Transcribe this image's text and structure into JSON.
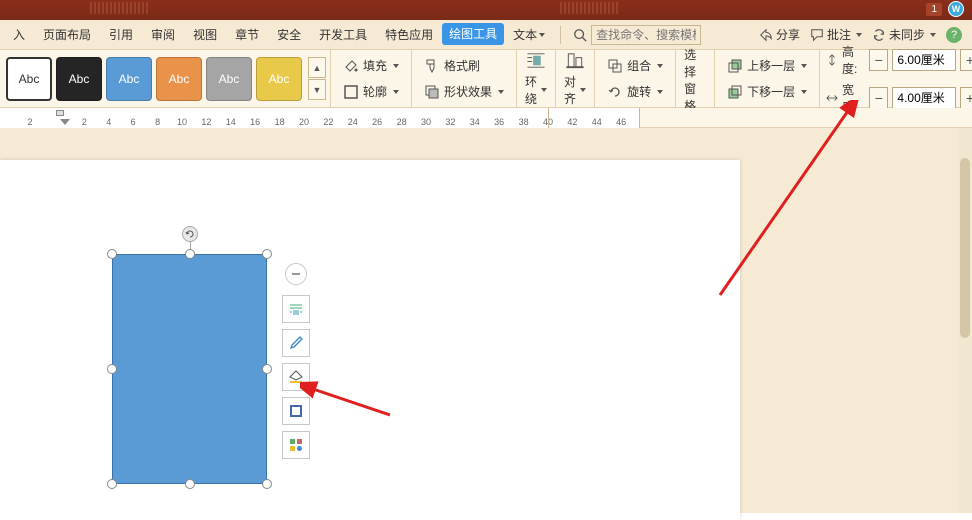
{
  "title_bar": {
    "notif_count": "1"
  },
  "menu": {
    "items": [
      "入",
      "页面布局",
      "引用",
      "审阅",
      "视图",
      "章节",
      "安全",
      "开发工具",
      "特色应用"
    ],
    "active": "绘图工具",
    "text_menu": "文本",
    "search_placeholder": "查找命令、搜索模板"
  },
  "right_menu": {
    "share": "分享",
    "comment": "批注",
    "sync": "未同步"
  },
  "styles": {
    "label": "Abc",
    "colors": [
      "#ffffff",
      "#252525",
      "#5a9bd5",
      "#e8924a",
      "#a5a5a5",
      "#e8c94a"
    ]
  },
  "toolbar": {
    "fill": "填充",
    "format_painter": "格式刷",
    "outline": "轮廓",
    "shape_effects": "形状效果",
    "wrap": "环绕",
    "align": "对齐",
    "group": "组合",
    "rotate": "旋转",
    "selection_pane": "选择窗格",
    "bring_forward": "上移一层",
    "send_backward": "下移一层"
  },
  "size": {
    "height_label": "高度:",
    "width_label": "宽度:",
    "height_value": "6.00厘米",
    "width_value": "4.00厘米"
  },
  "ruler": {
    "numbers": [
      2,
      2,
      4,
      6,
      8,
      10,
      12,
      14,
      16,
      18,
      20,
      22,
      24,
      26,
      28,
      30,
      32,
      34,
      36,
      38,
      40,
      42,
      44,
      46
    ]
  },
  "float_panel": {
    "collapse": "collapse-icon",
    "layout": "layout-options-icon",
    "format": "format-brush-icon",
    "fill": "shape-fill-icon",
    "outline": "shape-outline-icon",
    "more": "more-options-icon"
  }
}
